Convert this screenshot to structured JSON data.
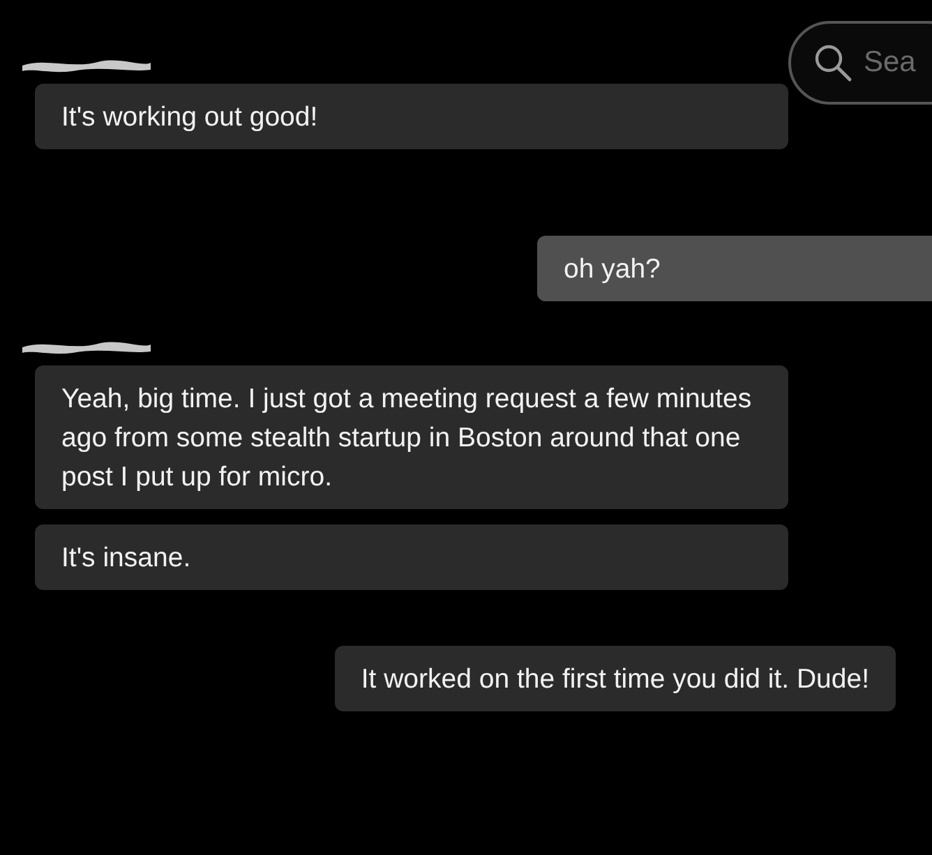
{
  "search": {
    "placeholder": "Sea"
  },
  "messages": [
    {
      "kind": "redacted-name"
    },
    {
      "kind": "incoming",
      "text": "It's working out good!"
    },
    {
      "kind": "outgoing",
      "text": "oh yah?",
      "highlighted": true
    },
    {
      "kind": "redacted-name"
    },
    {
      "kind": "incoming",
      "text": "Yeah, big time. I just got a meeting request a few minutes ago from some stealth startup in Boston around that one post I put up for micro."
    },
    {
      "kind": "incoming",
      "text": "It's insane."
    },
    {
      "kind": "outgoing",
      "text": "It worked on the first time you did it. Dude!",
      "highlighted": false
    }
  ]
}
